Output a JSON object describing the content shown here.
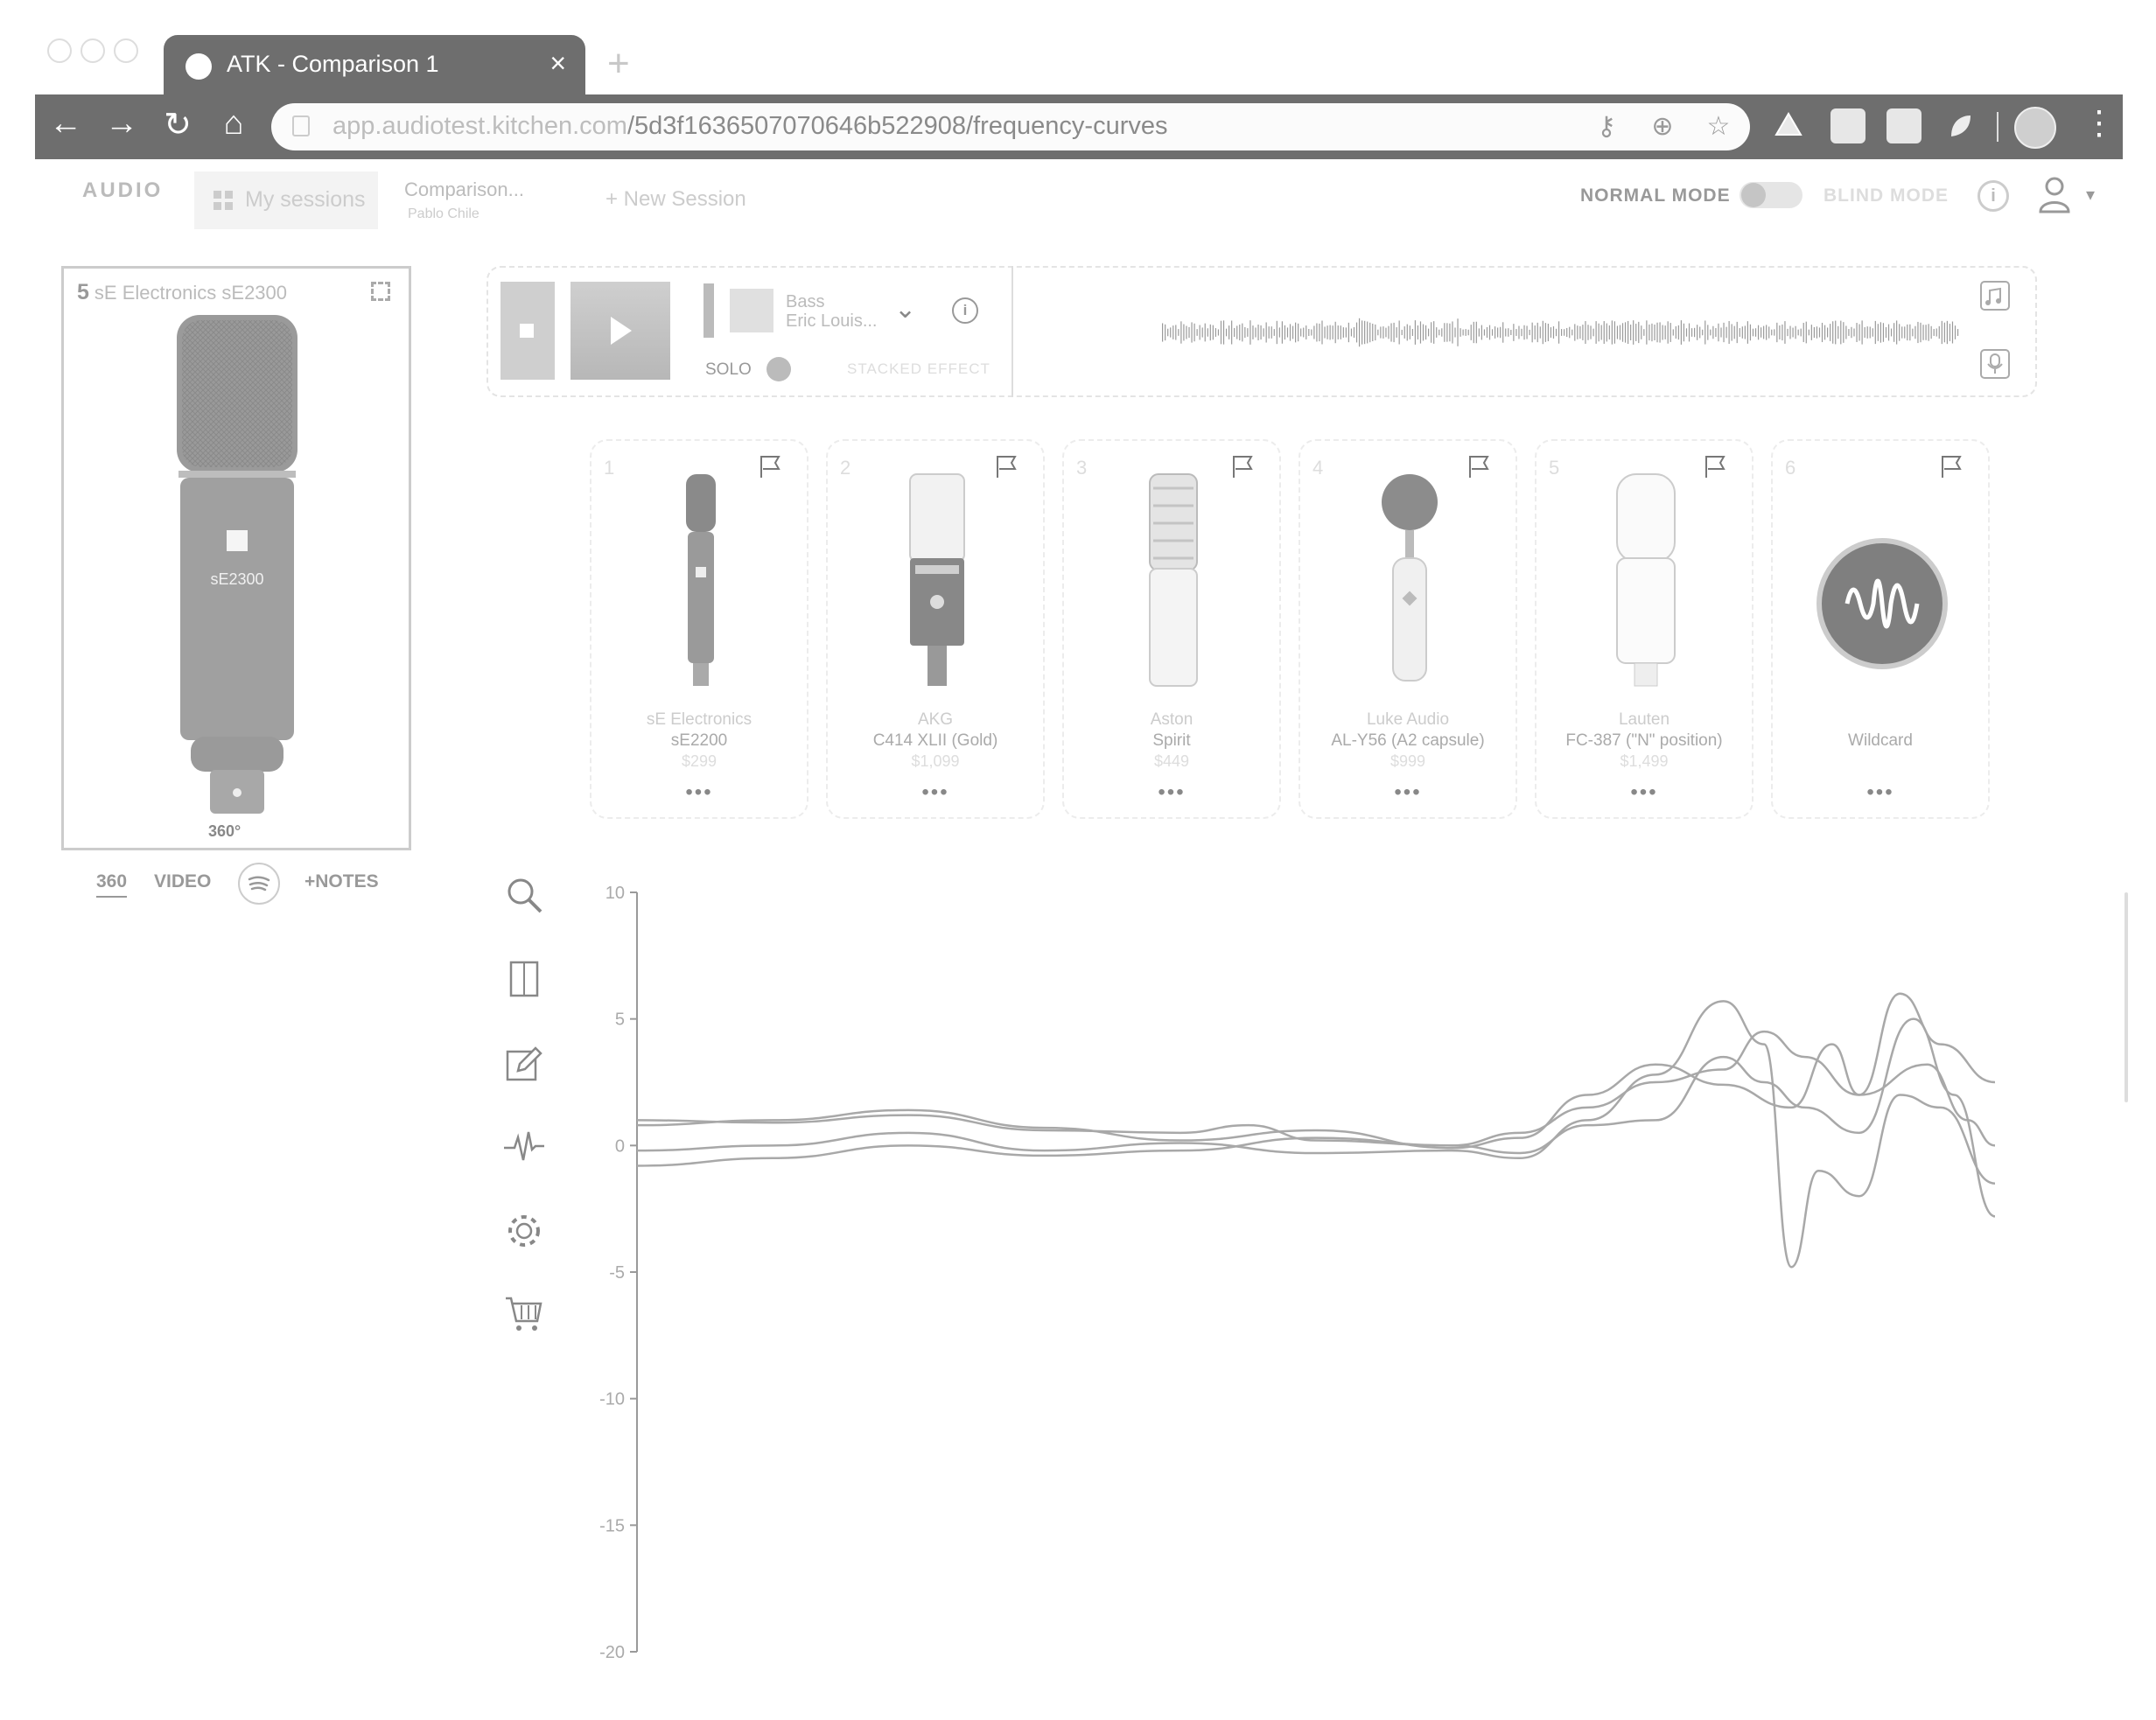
{
  "browser": {
    "tab_title": "ATK - Comparison 1",
    "tab_close": "×",
    "new_tab": "+",
    "url_host": "app.audiotest.kitchen.com",
    "url_path": "/5d3f1636507070646b522908/frequency-curves",
    "nav": {
      "back": "←",
      "forward": "→",
      "reload": "↻",
      "home": "⌂",
      "menu": "⋮"
    }
  },
  "header": {
    "logo": "AUDIO",
    "my_sessions": "My sessions",
    "comparison_title": "Comparison...",
    "comparison_subtitle": "Pablo Chile",
    "new_session": "+ New Session",
    "normal_mode": "NORMAL MODE",
    "blind_mode": "BLIND MODE",
    "info_glyph": "i",
    "caret": "▾"
  },
  "preview": {
    "index": "5",
    "title": "sE Electronics sE2300",
    "mic_label": "sE2300",
    "rotate_label": "360°",
    "nav": {
      "n360": "360",
      "video": "VIDEO",
      "notes": "+NOTES"
    }
  },
  "player": {
    "track_name": "Bass",
    "track_artist": "Eric Louis...",
    "caret": "⌄",
    "info_glyph": "i",
    "solo": "SOLO",
    "stacked_effect": "STACKED EFFECT"
  },
  "mics": [
    {
      "num": "1",
      "brand": "sE Electronics",
      "model": "sE2200",
      "price": "$299",
      "more": "•••"
    },
    {
      "num": "2",
      "brand": "AKG",
      "model": "C414 XLII (Gold)",
      "price": "$1,099",
      "more": "•••"
    },
    {
      "num": "3",
      "brand": "Aston",
      "model": "Spirit",
      "price": "$449",
      "more": "•••"
    },
    {
      "num": "4",
      "brand": "Luke Audio",
      "model": "AL-Y56 (A2 capsule)",
      "price": "$999",
      "more": "•••"
    },
    {
      "num": "5",
      "brand": "Lauten",
      "model": "FC-387 (\"N\" position)",
      "price": "$1,499",
      "more": "•••"
    },
    {
      "num": "6",
      "brand": "",
      "model": "Wildcard",
      "price": "",
      "more": "•••"
    }
  ],
  "tools": [
    "search-icon",
    "compare-icon",
    "edit-icon",
    "waveform-icon",
    "settings-icon",
    "cart-icon"
  ],
  "colors": {
    "chrome": "#6e6e6e",
    "curve": "#a8a8a8",
    "axis": "#9a9a9a"
  },
  "chart_data": {
    "type": "line",
    "title": "",
    "xlabel": "",
    "ylabel": "",
    "ylim": [
      -20,
      10
    ],
    "yticks": [
      10,
      5,
      0,
      -5,
      -10,
      -15,
      -20
    ],
    "grid": false,
    "legend": "none",
    "series": [
      {
        "points": [
          [
            0,
            1.0
          ],
          [
            0.1,
            0.9
          ],
          [
            0.2,
            1.2
          ],
          [
            0.3,
            0.6
          ],
          [
            0.4,
            0.5
          ],
          [
            0.45,
            0.8
          ],
          [
            0.5,
            0.2
          ],
          [
            0.6,
            0.0
          ],
          [
            0.65,
            0.5
          ],
          [
            0.7,
            1.5
          ],
          [
            0.75,
            2.5
          ],
          [
            0.8,
            3.0
          ],
          [
            0.83,
            4.5
          ],
          [
            0.86,
            3.5
          ],
          [
            0.9,
            2.0
          ],
          [
            0.95,
            3.2
          ],
          [
            0.98,
            1.0
          ],
          [
            1.0,
            0.0
          ]
        ]
      },
      {
        "points": [
          [
            0,
            0.8
          ],
          [
            0.1,
            1.0
          ],
          [
            0.2,
            1.4
          ],
          [
            0.3,
            0.7
          ],
          [
            0.4,
            0.2
          ],
          [
            0.5,
            0.6
          ],
          [
            0.6,
            -0.1
          ],
          [
            0.65,
            0.3
          ],
          [
            0.7,
            2.0
          ],
          [
            0.75,
            3.2
          ],
          [
            0.8,
            2.4
          ],
          [
            0.85,
            1.5
          ],
          [
            0.88,
            4.0
          ],
          [
            0.9,
            2.0
          ],
          [
            0.93,
            6.0
          ],
          [
            0.96,
            4.0
          ],
          [
            1.0,
            2.5
          ]
        ]
      },
      {
        "points": [
          [
            0,
            -0.2
          ],
          [
            0.1,
            0.0
          ],
          [
            0.2,
            0.5
          ],
          [
            0.3,
            -0.2
          ],
          [
            0.4,
            0.1
          ],
          [
            0.5,
            -0.3
          ],
          [
            0.6,
            -0.2
          ],
          [
            0.65,
            -0.5
          ],
          [
            0.7,
            1.0
          ],
          [
            0.75,
            2.8
          ],
          [
            0.8,
            5.7
          ],
          [
            0.83,
            4.0
          ],
          [
            0.85,
            -4.8
          ],
          [
            0.87,
            -1.0
          ],
          [
            0.9,
            -2.0
          ],
          [
            0.93,
            2.0
          ],
          [
            0.96,
            1.5
          ],
          [
            1.0,
            -1.5
          ]
        ]
      },
      {
        "points": [
          [
            0,
            -0.8
          ],
          [
            0.1,
            -0.5
          ],
          [
            0.2,
            0.0
          ],
          [
            0.3,
            -0.4
          ],
          [
            0.4,
            -0.2
          ],
          [
            0.5,
            0.3
          ],
          [
            0.6,
            0.0
          ],
          [
            0.65,
            -0.3
          ],
          [
            0.7,
            0.8
          ],
          [
            0.75,
            1.0
          ],
          [
            0.8,
            3.5
          ],
          [
            0.83,
            2.5
          ],
          [
            0.86,
            1.5
          ],
          [
            0.9,
            0.5
          ],
          [
            0.94,
            5.0
          ],
          [
            0.97,
            2.0
          ],
          [
            1.0,
            -2.8
          ]
        ]
      }
    ]
  }
}
